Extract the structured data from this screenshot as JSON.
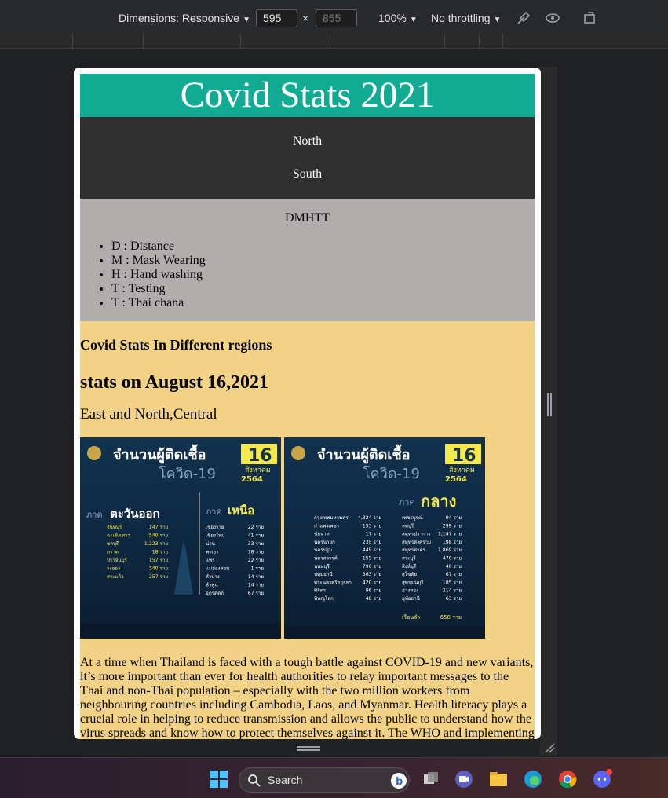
{
  "devtools": {
    "dimensions_label": "Dimensions: Responsive",
    "width_value": "595",
    "times": "×",
    "height_placeholder": "855",
    "zoom": "100%",
    "throttling": "No throttling"
  },
  "page": {
    "title": "Covid Stats 2021",
    "nav": [
      "North",
      "South"
    ],
    "dmhtt": {
      "title": "DMHTT",
      "items": [
        "D : Distance",
        "M : Mask Wearing",
        "H : Hand washing",
        "T : Testing",
        "T : Thai chana"
      ]
    },
    "content": {
      "heading": "Covid Stats In Different regions",
      "date_heading": "stats on August 16,2021",
      "subheading": "East and North,Central",
      "image1": {
        "title": "จำนวนผู้ติดเชื้อ",
        "subtitle": "โควิด-19",
        "day": "16",
        "month": "สิงหาคม",
        "year": "2564",
        "region_a": "ตะวันออก",
        "region_a_prefix": "ภาค",
        "region_b": "เหนือ",
        "region_b_prefix": "ภาค",
        "rows_a": [
          {
            "name": "จันทบุรี",
            "value": "147 ราย"
          },
          {
            "name": "ฉะเชิงเทรา",
            "value": "540 ราย"
          },
          {
            "name": "ชลบุรี",
            "value": "1,223 ราย"
          },
          {
            "name": "ตราด",
            "value": "18 ราย"
          },
          {
            "name": "ปราจีนบุรี",
            "value": "157 ราย"
          },
          {
            "name": "ระยอง",
            "value": "340 ราย"
          },
          {
            "name": "สระแก้ว",
            "value": "257 ราย"
          }
        ],
        "rows_b": [
          {
            "name": "เชียงราย",
            "value": "22 ราย"
          },
          {
            "name": "เชียงใหม่",
            "value": "41 ราย"
          },
          {
            "name": "น่าน",
            "value": "33 ราย"
          },
          {
            "name": "พะเยา",
            "value": "18 ราย"
          },
          {
            "name": "แพร่",
            "value": "22 ราย"
          },
          {
            "name": "แม่ฮ่องสอน",
            "value": "1 ราย"
          },
          {
            "name": "ลำปาง",
            "value": "14 ราย"
          },
          {
            "name": "ลำพูน",
            "value": "14 ราย"
          },
          {
            "name": "อุตรดิตถ์",
            "value": "67 ราย"
          }
        ]
      },
      "image2": {
        "title": "จำนวนผู้ติดเชื้อ",
        "subtitle": "โควิด-19",
        "day": "16",
        "month": "สิงหาคม",
        "year": "2564",
        "region": "กลาง",
        "region_prefix": "ภาค",
        "rows_a": [
          {
            "name": "กรุงเทพมหานคร",
            "value": "4,324 ราย"
          },
          {
            "name": "กำแพงเพชร",
            "value": "153 ราย"
          },
          {
            "name": "ชัยนาท",
            "value": "17 ราย"
          },
          {
            "name": "นครนายก",
            "value": "235 ราย"
          },
          {
            "name": "นครปฐม",
            "value": "449 ราย"
          },
          {
            "name": "นครสวรรค์",
            "value": "159 ราย"
          },
          {
            "name": "นนทบุรี",
            "value": "790 ราย"
          },
          {
            "name": "ปทุมธานี",
            "value": "363 ราย"
          },
          {
            "name": "พระนครศรีอยุธยา",
            "value": "420 ราย"
          },
          {
            "name": "พิจิตร",
            "value": "96 ราย"
          },
          {
            "name": "พิษณุโลก",
            "value": "48 ราย"
          }
        ],
        "rows_b": [
          {
            "name": "เพชรบูรณ์",
            "value": "94 ราย"
          },
          {
            "name": "ลพบุรี",
            "value": "299 ราย"
          },
          {
            "name": "สมุทรปราการ",
            "value": "1,147 ราย"
          },
          {
            "name": "สมุทรสงคราม",
            "value": "198 ราย"
          },
          {
            "name": "สมุทรสาคร",
            "value": "1,869 ราย"
          },
          {
            "name": "สระบุรี",
            "value": "470 ราย"
          },
          {
            "name": "สิงห์บุรี",
            "value": "40 ราย"
          },
          {
            "name": "สุโขทัย",
            "value": "67 ราย"
          },
          {
            "name": "สุพรรณบุรี",
            "value": "185 ราย"
          },
          {
            "name": "อ่างทอง",
            "value": "214 ราย"
          },
          {
            "name": "อุทัยธานี",
            "value": "63 ราย"
          }
        ],
        "prison_label": "เรือนจำ",
        "prison_value": "658 ราย"
      },
      "paragraph": "At a time when Thailand is faced with a tough battle against COVID-19 and new variants, it’s more important than ever for health authorities to relay important messages to the Thai and non-Thai population – especially with the two million workers from neighbouring countries including Cambodia, Laos, and Myanmar. Health literacy plays a crucial role in helping to reduce transmission and allows the public to understand how the virus spreads and know how to protect themselves against it. The WHO and implementing"
    }
  },
  "taskbar": {
    "search_label": "Search"
  },
  "colors": {
    "header": "#11ab93",
    "nav": "#2f2f2f",
    "dmhtt": "#b1adad",
    "content": "#f1d287",
    "infographic_bg": "#0f2a44",
    "infographic_yellow": "#f5e84a"
  }
}
